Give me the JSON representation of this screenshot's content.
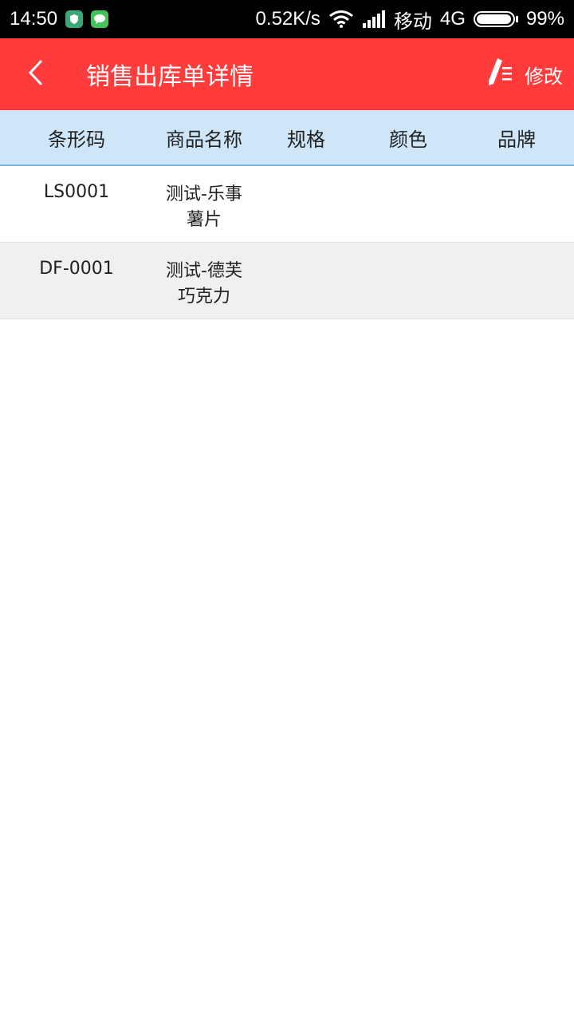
{
  "status_bar": {
    "time": "14:50",
    "net_speed": "0.52K/s",
    "carrier": "移动",
    "network_type": "4G",
    "battery": "99%",
    "battery_level": 0.99
  },
  "app_bar": {
    "title": "销售出库单详情",
    "edit_label": "修改"
  },
  "table": {
    "columns": [
      "条形码",
      "商品名称",
      "规格",
      "颜色",
      "品牌"
    ],
    "rows": [
      {
        "barcode": "LS0001",
        "name_line1": "测试-乐事",
        "name_line2": "薯片",
        "spec": "",
        "color": "",
        "brand": ""
      },
      {
        "barcode": "DF-0001",
        "name_line1": "测试-德芙",
        "name_line2": "巧克力",
        "spec": "",
        "color": "",
        "brand": ""
      }
    ]
  },
  "colors": {
    "accent": "#ff3b3b",
    "header_bg": "#cfe6f8",
    "alt_row": "#f0f0f0"
  }
}
